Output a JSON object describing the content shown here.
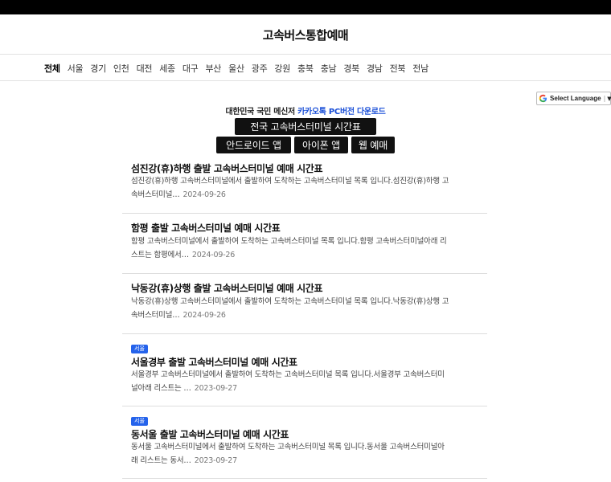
{
  "site": {
    "title": "고속버스통합예매"
  },
  "nav": {
    "items": [
      "전체",
      "서울",
      "경기",
      "인천",
      "대전",
      "세종",
      "대구",
      "부산",
      "울산",
      "광주",
      "강원",
      "충북",
      "충남",
      "경북",
      "경남",
      "전북",
      "전남"
    ],
    "active": "전체"
  },
  "translate": {
    "label": "Select Language"
  },
  "promo": {
    "text": "대한민국 국민 메신저 ",
    "link": "카카오톡 PC버전 다운로드"
  },
  "buttons": {
    "terminal_timetable": "전국 고속버스터미널 시간표",
    "android_app": "안드로이드 앱",
    "iphone_app": "아이폰 앱",
    "web_booking": "웹 예매"
  },
  "colors": {
    "accent": "#1a4fd8",
    "badge": "#2563eb",
    "dark_button": "#111111"
  },
  "articles": [
    {
      "badge": "",
      "title": "섬진강(휴)하행 출발 고속버스터미널 예매 시간표",
      "desc_line1": "섬진강(휴)하행 고속버스터미널에서 출발하여 도착하는 고속버스터미널 목록 입니다.섬진강(휴)하행 고",
      "desc_line2": "속버스터미널…",
      "date": "2024-09-26"
    },
    {
      "badge": "",
      "title": "함평 출발 고속버스터미널 예매 시간표",
      "desc_line1": "함평 고속버스터미널에서 출발하여 도착하는 고속버스터미널 목록 입니다.함평 고속버스터미널아래 리",
      "desc_line2": "스트는 함평에서…",
      "date": "2024-09-26"
    },
    {
      "badge": "",
      "title": "낙동강(휴)상행 출발 고속버스터미널 예매 시간표",
      "desc_line1": "낙동강(휴)상행 고속버스터미널에서 출발하여 도착하는 고속버스터미널 목록 입니다.낙동강(휴)상행 고",
      "desc_line2": "속버스터미널…",
      "date": "2024-09-26"
    },
    {
      "badge": "서울",
      "title": "서울경부 출발 고속버스터미널 예매 시간표",
      "desc_line1": "서울경부 고속버스터미널에서 출발하여 도착하는 고속버스터미널 목록 입니다.서울경부 고속버스터미",
      "desc_line2": "널아래 리스트는 …",
      "date": "2023-09-27"
    },
    {
      "badge": "서울",
      "title": "동서울 출발 고속버스터미널 예매 시간표",
      "desc_line1": "동서울 고속버스터미널에서 출발하여 도착하는 고속버스터미널 목록 입니다.동서울 고속버스터미널아",
      "desc_line2": "래 리스트는 동서…",
      "date": "2023-09-27"
    }
  ]
}
